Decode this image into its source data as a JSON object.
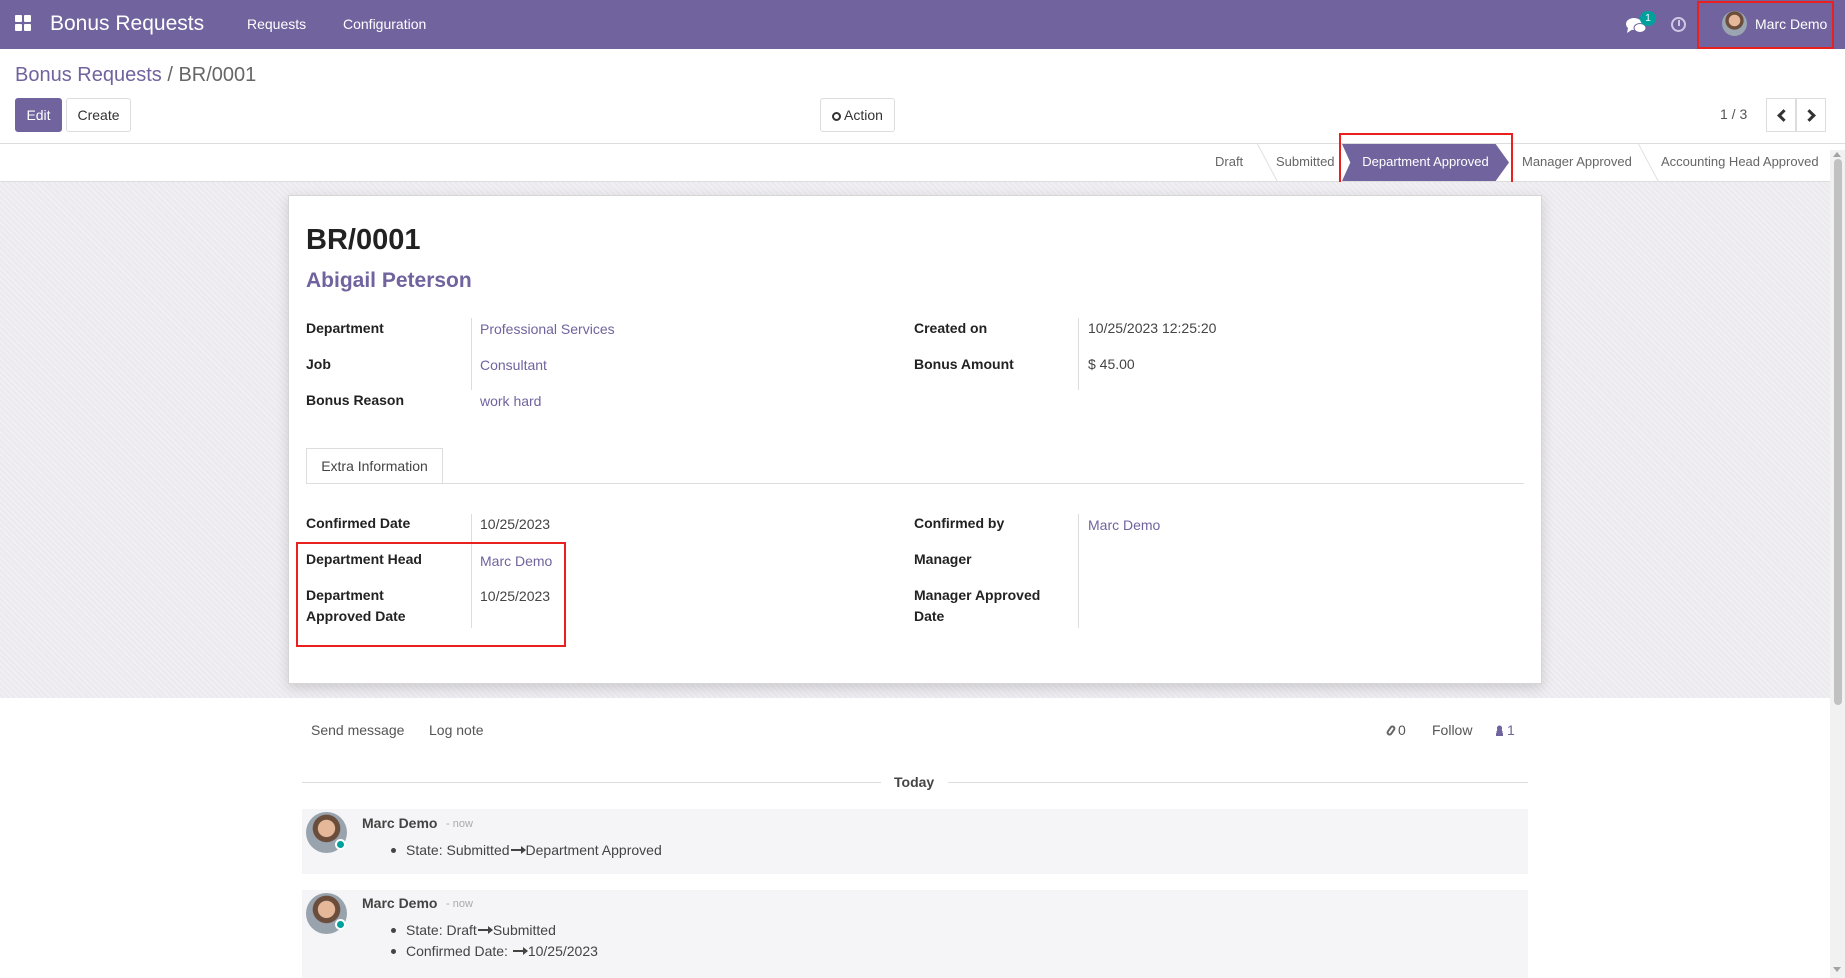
{
  "topbar": {
    "app_name": "Bonus Requests",
    "menus": [
      "Requests",
      "Configuration"
    ],
    "chat_count": "1",
    "user_name": "Marc Demo"
  },
  "breadcrumb": {
    "parent": "Bonus Requests",
    "separator": "/",
    "current": "BR/0001"
  },
  "buttons": {
    "edit": "Edit",
    "create": "Create",
    "action": "Action"
  },
  "pager": "1 / 3",
  "statusbar": {
    "stages": [
      "Draft",
      "Submitted",
      "Department Approved",
      "Manager Approved",
      "Accounting Head Approved"
    ],
    "active": "Department Approved"
  },
  "record": {
    "ref": "BR/0001",
    "employee": "Abigail Peterson",
    "fields_left": [
      {
        "label": "Department",
        "value": "Professional Services"
      },
      {
        "label": "Job",
        "value": "Consultant"
      },
      {
        "label": "Bonus Reason",
        "value": "work hard"
      }
    ],
    "fields_right": [
      {
        "label": "Created on",
        "value": "10/25/2023 12:25:20"
      },
      {
        "label": "Bonus Amount",
        "value": "$ 45.00"
      }
    ]
  },
  "tab": {
    "label": "Extra Information"
  },
  "extra": {
    "left": [
      {
        "label": "Confirmed Date",
        "value": "10/25/2023"
      },
      {
        "label": "Department Head",
        "value": "Marc Demo"
      },
      {
        "label_line1": "Department",
        "label_line2": "Approved Date",
        "value": "10/25/2023"
      }
    ],
    "right": [
      {
        "label": "Confirmed by",
        "value": "Marc Demo"
      },
      {
        "label": "Manager",
        "value": ""
      },
      {
        "label_line1": "Manager Approved",
        "label_line2": "Date",
        "value": ""
      }
    ]
  },
  "chatter": {
    "send_message": "Send message",
    "log_note": "Log note",
    "attachments": "0",
    "follow": "Follow",
    "followers": "1",
    "date_separator": "Today",
    "messages": [
      {
        "author": "Marc Demo",
        "time": "- now",
        "lines": [
          {
            "label": "State:",
            "from": "Submitted",
            "to": "Department Approved"
          }
        ]
      },
      {
        "author": "Marc Demo",
        "time": "- now",
        "lines": [
          {
            "label": "State:",
            "from": "Draft",
            "to": "Submitted"
          },
          {
            "label": "Confirmed Date:",
            "from": "",
            "to": "10/25/2023"
          }
        ]
      }
    ]
  }
}
